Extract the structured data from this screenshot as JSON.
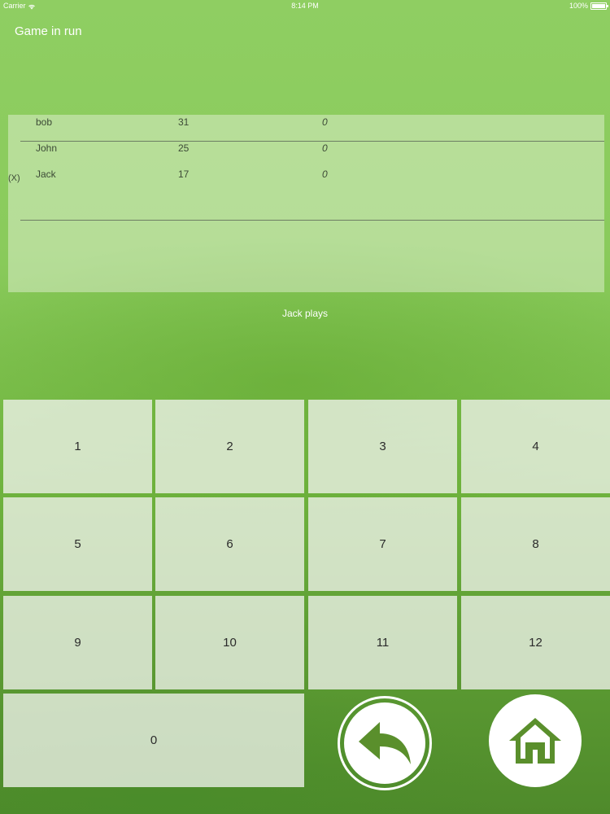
{
  "status_bar": {
    "carrier": "Carrier",
    "time": "8:14 PM",
    "battery": "100%",
    "battery_level": 1.0
  },
  "header": {
    "title": "Game in run"
  },
  "scoreboard": {
    "players": [
      {
        "marker": "",
        "name": "bob",
        "score": "31",
        "extra": "0"
      },
      {
        "marker": "",
        "name": "John",
        "score": "25",
        "extra": "0"
      },
      {
        "marker": "(X)",
        "name": "Jack",
        "score": "17",
        "extra": "0"
      }
    ]
  },
  "turn": {
    "label": "Jack plays"
  },
  "keypad": {
    "keys": [
      "1",
      "2",
      "3",
      "4",
      "5",
      "6",
      "7",
      "8",
      "9",
      "10",
      "11",
      "12",
      "0"
    ]
  },
  "actions": {
    "undo_icon": "undo-arrow-icon",
    "home_icon": "home-icon",
    "icon_color": "#5a8f2c"
  }
}
